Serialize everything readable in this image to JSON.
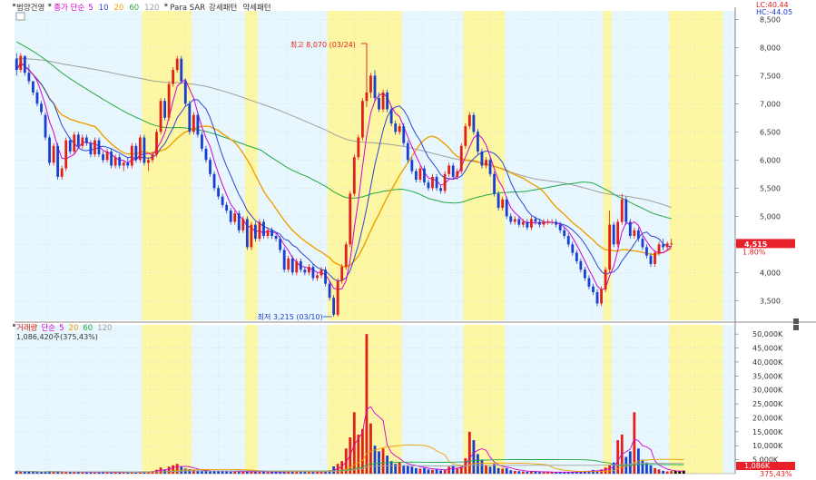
{
  "chart_data": [
    {
      "type": "candlestick",
      "header": {
        "name": "범양건영",
        "series_prefix": "종가 단순",
        "ma_periods": [
          "5",
          "10",
          "20",
          "60",
          "120"
        ],
        "ma_colors": [
          "#d400d4",
          "#2d45d8",
          "#f0a000",
          "#21a84a",
          "#a0a0a0"
        ],
        "extra": "Para SAR",
        "pattern_up": "강세패턴",
        "pattern_down": "약세패턴"
      },
      "top_right": {
        "lc": "LC:40.44",
        "hc": "HC:-44.05"
      },
      "y_range": [
        3150,
        8650
      ],
      "y_ticks": [
        "8,500",
        "8,000",
        "7,500",
        "7,000",
        "6,500",
        "6,000",
        "5,500",
        "5,000",
        "4,500",
        "4,000",
        "3,500"
      ],
      "high_annotation": {
        "label": "최고 8,070 (03/24)",
        "value": 8070
      },
      "low_annotation": {
        "label": "최저 3,215 (03/10)",
        "value": 3215
      },
      "last_price": {
        "value": "4,515",
        "change": "1.80%",
        "price": 4515
      },
      "highlight_bands": [
        [
          31,
          42
        ],
        [
          56,
          58
        ],
        [
          76,
          93
        ],
        [
          109,
          118
        ],
        [
          143,
          144
        ],
        [
          159,
          171
        ]
      ],
      "n_candles": 175,
      "ohlc": [
        [
          7800,
          7900,
          7500,
          7600
        ],
        [
          7600,
          7900,
          7550,
          7850
        ],
        [
          7850,
          7850,
          7500,
          7550
        ],
        [
          7550,
          7700,
          7350,
          7400
        ],
        [
          7400,
          7400,
          7150,
          7200
        ],
        [
          7200,
          7250,
          6950,
          7000
        ],
        [
          7000,
          7050,
          6800,
          6850
        ],
        [
          6800,
          6850,
          6350,
          6400
        ],
        [
          6400,
          6450,
          5900,
          5950
        ],
        [
          5950,
          6300,
          5900,
          6250
        ],
        [
          6250,
          6300,
          5650,
          5700
        ],
        [
          5700,
          5900,
          5650,
          5850
        ],
        [
          5850,
          6400,
          5800,
          6350
        ],
        [
          6350,
          6400,
          6100,
          6150
        ],
        [
          6150,
          6500,
          6100,
          6450
        ],
        [
          6450,
          6500,
          6200,
          6250
        ],
        [
          6250,
          6450,
          6200,
          6400
        ],
        [
          6400,
          6450,
          6250,
          6300
        ],
        [
          6300,
          6350,
          6050,
          6100
        ],
        [
          6100,
          6400,
          6050,
          6350
        ],
        [
          6350,
          6400,
          6050,
          6100
        ],
        [
          6100,
          6150,
          5950,
          6000
        ],
        [
          6000,
          6200,
          5950,
          6150
        ],
        [
          6150,
          6200,
          5850,
          5900
        ],
        [
          5900,
          6100,
          5850,
          6050
        ],
        [
          6050,
          6100,
          5850,
          5900
        ],
        [
          5900,
          6000,
          5800,
          5950
        ],
        [
          5950,
          6050,
          5850,
          5900
        ],
        [
          5900,
          6300,
          5850,
          6250
        ],
        [
          6250,
          6300,
          5950,
          6000
        ],
        [
          6000,
          6450,
          5950,
          6400
        ],
        [
          6400,
          6450,
          5900,
          5950
        ],
        [
          5950,
          6050,
          5800,
          6000
        ],
        [
          6000,
          6150,
          5950,
          6100
        ],
        [
          6100,
          6550,
          6050,
          6500
        ],
        [
          6500,
          7100,
          6450,
          7050
        ],
        [
          7050,
          7100,
          6700,
          6750
        ],
        [
          6750,
          7400,
          6700,
          7350
        ],
        [
          7350,
          7650,
          7300,
          7600
        ],
        [
          7600,
          7850,
          7550,
          7800
        ],
        [
          7800,
          7850,
          7350,
          7400
        ],
        [
          7400,
          7450,
          6950,
          7000
        ],
        [
          7000,
          7050,
          6450,
          6500
        ],
        [
          6500,
          6850,
          6450,
          6800
        ],
        [
          6800,
          6850,
          6400,
          6450
        ],
        [
          6450,
          6500,
          6150,
          6200
        ],
        [
          6200,
          6250,
          5950,
          6000
        ],
        [
          6000,
          6050,
          5700,
          5750
        ],
        [
          5750,
          5800,
          5450,
          5500
        ],
        [
          5500,
          5550,
          5300,
          5350
        ],
        [
          5350,
          5400,
          5150,
          5200
        ],
        [
          5200,
          5250,
          5050,
          5100
        ],
        [
          5100,
          5150,
          4850,
          4900
        ],
        [
          4900,
          5100,
          4850,
          5050
        ],
        [
          5050,
          5100,
          4700,
          4750
        ],
        [
          4750,
          5000,
          4700,
          4950
        ],
        [
          4950,
          5000,
          4400,
          4450
        ],
        [
          4450,
          4900,
          4400,
          4850
        ],
        [
          4850,
          4900,
          4550,
          4600
        ],
        [
          4600,
          4950,
          4550,
          4900
        ],
        [
          4900,
          4950,
          4600,
          4650
        ],
        [
          4650,
          4800,
          4600,
          4750
        ],
        [
          4750,
          4800,
          4600,
          4650
        ],
        [
          4650,
          4700,
          4550,
          4600
        ],
        [
          4600,
          4650,
          4350,
          4400
        ],
        [
          4400,
          4450,
          4000,
          4050
        ],
        [
          4050,
          4300,
          4000,
          4250
        ],
        [
          4250,
          4300,
          3950,
          4000
        ],
        [
          4000,
          4250,
          3950,
          4200
        ],
        [
          4200,
          4250,
          4000,
          4050
        ],
        [
          4050,
          4100,
          3950,
          4000
        ],
        [
          4000,
          4150,
          3950,
          4100
        ],
        [
          4100,
          4150,
          3850,
          3900
        ],
        [
          3900,
          4000,
          3850,
          3950
        ],
        [
          3950,
          4100,
          3900,
          4050
        ],
        [
          4050,
          4100,
          3750,
          3800
        ],
        [
          3800,
          3850,
          3500,
          3550
        ],
        [
          3550,
          3600,
          3215,
          3250
        ],
        [
          3250,
          3900,
          3215,
          3850
        ],
        [
          3850,
          4150,
          3800,
          4100
        ],
        [
          4100,
          4550,
          4050,
          4500
        ],
        [
          4500,
          5450,
          4450,
          5400
        ],
        [
          5400,
          6100,
          5350,
          6050
        ],
        [
          6050,
          6450,
          6000,
          6400
        ],
        [
          6400,
          7100,
          6350,
          7050
        ],
        [
          7050,
          8070,
          7000,
          7200
        ],
        [
          7200,
          7550,
          7100,
          7500
        ],
        [
          7500,
          7600,
          7050,
          7100
        ],
        [
          7100,
          7200,
          6850,
          6900
        ],
        [
          6900,
          7250,
          6850,
          7200
        ],
        [
          7200,
          7250,
          6850,
          6900
        ],
        [
          6900,
          6950,
          6600,
          6650
        ],
        [
          6650,
          6700,
          6450,
          6500
        ],
        [
          6500,
          6650,
          6450,
          6600
        ],
        [
          6600,
          6650,
          6250,
          6300
        ],
        [
          6300,
          6350,
          5950,
          6000
        ],
        [
          6000,
          6050,
          5750,
          5800
        ],
        [
          5800,
          5850,
          5600,
          5650
        ],
        [
          5650,
          5900,
          5600,
          5850
        ],
        [
          5850,
          5900,
          5550,
          5600
        ],
        [
          5600,
          5650,
          5450,
          5500
        ],
        [
          5500,
          5750,
          5450,
          5700
        ],
        [
          5700,
          5750,
          5450,
          5500
        ],
        [
          5500,
          5550,
          5400,
          5450
        ],
        [
          5450,
          5800,
          5400,
          5750
        ],
        [
          5750,
          5950,
          5700,
          5900
        ],
        [
          5900,
          5950,
          5650,
          5700
        ],
        [
          5700,
          5850,
          5650,
          5800
        ],
        [
          5800,
          6300,
          5750,
          6250
        ],
        [
          6250,
          6650,
          6200,
          6600
        ],
        [
          6600,
          6850,
          6550,
          6800
        ],
        [
          6800,
          6850,
          6450,
          6500
        ],
        [
          6500,
          6550,
          6100,
          6150
        ],
        [
          6150,
          6200,
          5850,
          5900
        ],
        [
          5900,
          6050,
          5850,
          6000
        ],
        [
          6000,
          6050,
          5700,
          5750
        ],
        [
          5750,
          5800,
          5350,
          5400
        ],
        [
          5400,
          5450,
          5100,
          5150
        ],
        [
          5150,
          5350,
          5100,
          5300
        ],
        [
          5300,
          5350,
          4950,
          5000
        ],
        [
          5000,
          5050,
          4850,
          4900
        ],
        [
          4900,
          5000,
          4850,
          4950
        ],
        [
          4950,
          5000,
          4800,
          4850
        ],
        [
          4850,
          4950,
          4800,
          4900
        ],
        [
          4900,
          4950,
          4750,
          4800
        ],
        [
          4800,
          5000,
          4750,
          4950
        ],
        [
          4950,
          5000,
          4850,
          4900
        ],
        [
          4900,
          4950,
          4800,
          4850
        ],
        [
          4850,
          4950,
          4800,
          4900
        ],
        [
          4900,
          4950,
          4850,
          4900
        ],
        [
          4900,
          4950,
          4850,
          4900
        ],
        [
          4900,
          4950,
          4800,
          4850
        ],
        [
          4850,
          4900,
          4700,
          4750
        ],
        [
          4750,
          4800,
          4600,
          4650
        ],
        [
          4650,
          4700,
          4450,
          4500
        ],
        [
          4500,
          4550,
          4300,
          4350
        ],
        [
          4350,
          4400,
          4150,
          4200
        ],
        [
          4200,
          4250,
          4000,
          4050
        ],
        [
          4050,
          4100,
          3850,
          3900
        ],
        [
          3900,
          3950,
          3700,
          3750
        ],
        [
          3750,
          3800,
          3600,
          3650
        ],
        [
          3650,
          3700,
          3400,
          3450
        ],
        [
          3450,
          3750,
          3400,
          3700
        ],
        [
          3700,
          4100,
          3650,
          4050
        ],
        [
          4050,
          5100,
          4000,
          4850
        ],
        [
          4850,
          4900,
          4450,
          4500
        ],
        [
          4500,
          4950,
          4450,
          4900
        ],
        [
          4900,
          5400,
          4850,
          5300
        ],
        [
          5300,
          5350,
          4850,
          4900
        ],
        [
          4900,
          4950,
          4600,
          4650
        ],
        [
          4650,
          4800,
          4600,
          4750
        ],
        [
          4750,
          4800,
          4550,
          4600
        ],
        [
          4600,
          4650,
          4400,
          4450
        ],
        [
          4450,
          4500,
          4250,
          4300
        ],
        [
          4300,
          4350,
          4100,
          4150
        ],
        [
          4150,
          4400,
          4100,
          4350
        ],
        [
          4350,
          4550,
          4300,
          4500
        ],
        [
          4500,
          4600,
          4400,
          4450
        ],
        [
          4450,
          4550,
          4400,
          4515
        ],
        [
          4515,
          4600,
          4450,
          4515
        ]
      ]
    },
    {
      "type": "bar",
      "header": {
        "label": "거래량",
        "prefix": "단순",
        "ma_periods": [
          "5",
          "20",
          "60",
          "120"
        ]
      },
      "info": "1,086,420주(375,43%)",
      "y_range": [
        0,
        52000
      ],
      "y_ticks": [
        "50,000K",
        "45,000K",
        "40,000K",
        "35,000K",
        "30,000K",
        "25,000K",
        "20,000K",
        "15,000K",
        "10,000K",
        "5,000K"
      ],
      "last_volume": {
        "value": "1,086K",
        "ratio": "375,43%"
      },
      "volume_k": [
        900,
        800,
        700,
        700,
        600,
        500,
        600,
        800,
        900,
        700,
        600,
        500,
        700,
        600,
        600,
        500,
        500,
        500,
        600,
        600,
        500,
        500,
        400,
        500,
        400,
        500,
        500,
        600,
        500,
        400,
        800,
        700,
        800,
        900,
        1400,
        2200,
        1500,
        2500,
        3000,
        3500,
        2400,
        1800,
        1600,
        1300,
        1200,
        1000,
        900,
        800,
        1000,
        1100,
        900,
        800,
        700,
        700,
        600,
        700,
        800,
        700,
        600,
        900,
        700,
        600,
        600,
        500,
        600,
        1000,
        900,
        800,
        1000,
        700,
        700,
        600,
        700,
        600,
        600,
        1000,
        1200,
        2600,
        3500,
        4500,
        9000,
        13000,
        22000,
        14000,
        16000,
        50000,
        18000,
        10000,
        8000,
        9000,
        6500,
        4500,
        3500,
        4000,
        3000,
        3000,
        2500,
        2000,
        1800,
        2000,
        1500,
        1400,
        1500,
        1200,
        1300,
        2500,
        3000,
        1800,
        2500,
        5500,
        15000,
        12000,
        7000,
        5000,
        3000,
        2500,
        3500,
        2000,
        1800,
        2000,
        1200,
        1000,
        900,
        800,
        700,
        800,
        700,
        600,
        600,
        500,
        600,
        500,
        500,
        600,
        500,
        600,
        700,
        800,
        1000,
        1000,
        1300,
        1100,
        1500,
        2200,
        3000,
        4000,
        12000,
        14000,
        6000,
        8000,
        22000,
        9000,
        5000,
        4000,
        3000,
        2000,
        1500,
        1000,
        800,
        900,
        1000,
        800,
        1086
      ]
    }
  ]
}
